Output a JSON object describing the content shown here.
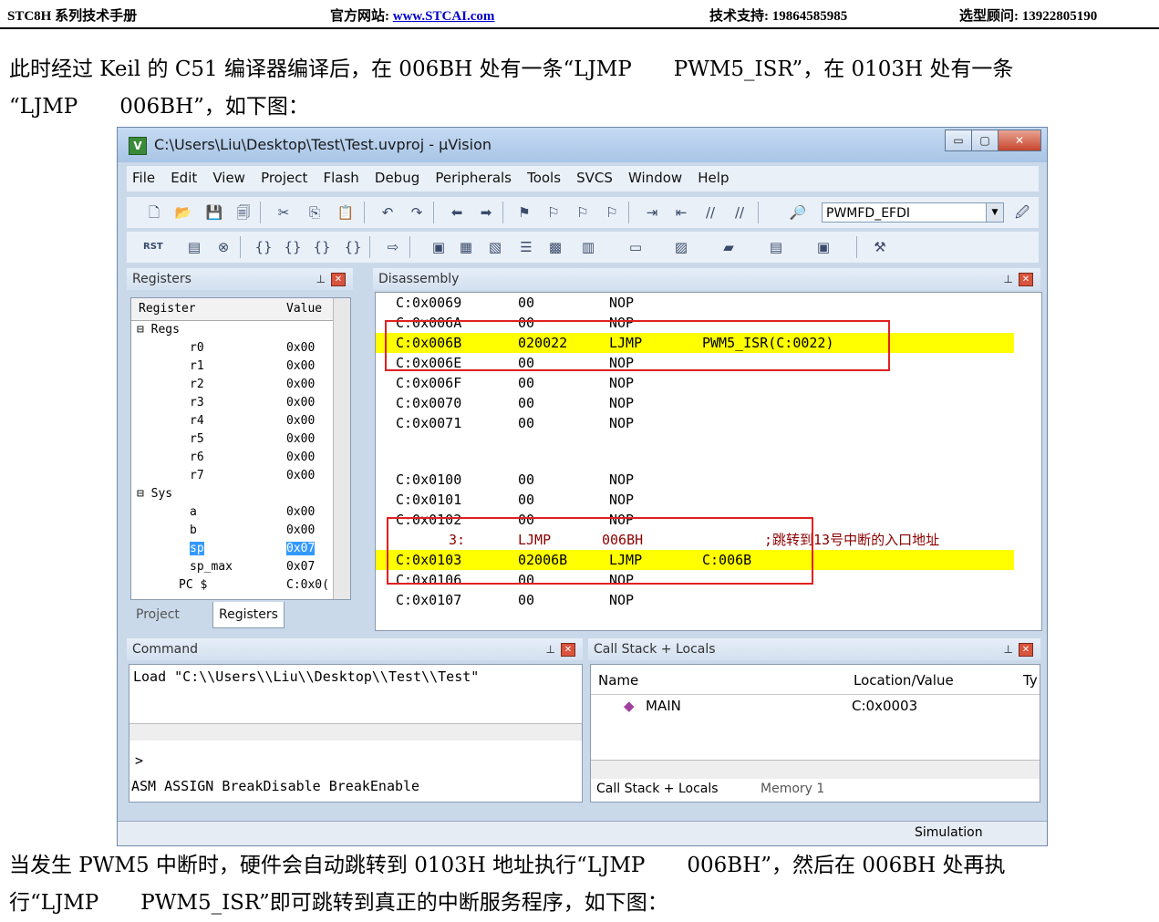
{
  "doc_header": {
    "manual": "STC8H 系列技术手册",
    "website_label": "官方网站:",
    "website": "www.STCAI.com",
    "support": "技术支持: 19864585985",
    "advisor": "选型顾问: 13922805190"
  },
  "paragraphs": {
    "top_line1": "此时经过 Keil 的 C51 编译器编译后，在 006BH 处有一条“LJMP　　PWM5_ISR”，在 0103H 处有一条",
    "top_line2": "“LJMP　　006BH”，如下图：",
    "bottom_line1": "当发生 PWM5 中断时，硬件会自动跳转到 0103H 地址执行“LJMP　　006BH”，然后在 006BH 处再执",
    "bottom_line2": "行“LJMP　　PWM5_ISR”即可跳转到真正的中断服务程序，如下图："
  },
  "window": {
    "title": "C:\\Users\\Liu\\Desktop\\Test\\Test.uvproj - μVision",
    "minimize": "▭",
    "maximize": "▢",
    "close": "✕"
  },
  "menu": [
    "File",
    "Edit",
    "View",
    "Project",
    "Flash",
    "Debug",
    "Peripherals",
    "Tools",
    "SVCS",
    "Window",
    "Help"
  ],
  "toolbar": {
    "target_select": "PWMFD_EFDI",
    "rst_label": "RST"
  },
  "registers": {
    "title": "Registers",
    "col_register": "Register",
    "col_value": "Value",
    "rows": [
      {
        "name": "Regs",
        "value": ""
      },
      {
        "name": "r0",
        "value": "0x00"
      },
      {
        "name": "r1",
        "value": "0x00"
      },
      {
        "name": "r2",
        "value": "0x00"
      },
      {
        "name": "r3",
        "value": "0x00"
      },
      {
        "name": "r4",
        "value": "0x00"
      },
      {
        "name": "r5",
        "value": "0x00"
      },
      {
        "name": "r6",
        "value": "0x00"
      },
      {
        "name": "r7",
        "value": "0x00"
      },
      {
        "name": "Sys",
        "value": ""
      },
      {
        "name": "a",
        "value": "0x00"
      },
      {
        "name": "b",
        "value": "0x00"
      },
      {
        "name": "sp",
        "value": "0x07"
      },
      {
        "name": "sp_max",
        "value": "0x07"
      },
      {
        "name": "PC  $",
        "value": "C:0x0("
      }
    ],
    "tab_project": "Project",
    "tab_registers": "Registers"
  },
  "disassembly": {
    "title": "Disassembly",
    "rows": [
      {
        "addr": "C:0x0069",
        "code": "00",
        "mnemonic": "NOP",
        "operand": "",
        "hl": false
      },
      {
        "addr": "C:0x006A",
        "code": "00",
        "mnemonic": "NOP",
        "operand": "",
        "hl": false
      },
      {
        "addr": "C:0x006B",
        "code": "020022",
        "mnemonic": "LJMP",
        "operand": "PWM5_ISR(C:0022)",
        "hl": true
      },
      {
        "addr": "C:0x006E",
        "code": "00",
        "mnemonic": "NOP",
        "operand": "",
        "hl": false
      },
      {
        "addr": "C:0x006F",
        "code": "00",
        "mnemonic": "NOP",
        "operand": "",
        "hl": false
      },
      {
        "addr": "C:0x0070",
        "code": "00",
        "mnemonic": "NOP",
        "operand": "",
        "hl": false
      },
      {
        "addr": "C:0x0071",
        "code": "00",
        "mnemonic": "NOP",
        "operand": "",
        "hl": false
      },
      {
        "addr": "C:0x0100",
        "code": "00",
        "mnemonic": "NOP",
        "operand": "",
        "hl": false
      },
      {
        "addr": "C:0x0101",
        "code": "00",
        "mnemonic": "NOP",
        "operand": "",
        "hl": false
      },
      {
        "addr": "C:0x0102",
        "code": "00",
        "mnemonic": "NOP",
        "operand": "",
        "hl": false
      },
      {
        "addr": "3:",
        "code": "LJMP",
        "mnemonic": "006BH",
        "operand": ";跳转到13号中断的入口地址",
        "src": true
      },
      {
        "addr": "C:0x0103",
        "code": "02006B",
        "mnemonic": "LJMP",
        "operand": "C:006B",
        "hl": true
      },
      {
        "addr": "C:0x0106",
        "code": "00",
        "mnemonic": "NOP",
        "operand": "",
        "hl": false
      },
      {
        "addr": "C:0x0107",
        "code": "00",
        "mnemonic": "NOP",
        "operand": "",
        "hl": false
      }
    ]
  },
  "command": {
    "title": "Command",
    "output": "Load \"C:\\\\Users\\\\Liu\\\\Desktop\\\\Test\\\\Test\"",
    "prompt": ">",
    "hint": "ASM ASSIGN BreakDisable BreakEnable"
  },
  "callstack": {
    "title": "Call Stack + Locals",
    "col_name": "Name",
    "col_location": "Location/Value",
    "col_type": "Ty",
    "rows": [
      {
        "name": "MAIN",
        "location": "C:0x0003"
      }
    ],
    "tab_callstack": "Call Stack + Locals",
    "tab_memory": "Memory 1"
  },
  "status": {
    "mode": "Simulation"
  }
}
